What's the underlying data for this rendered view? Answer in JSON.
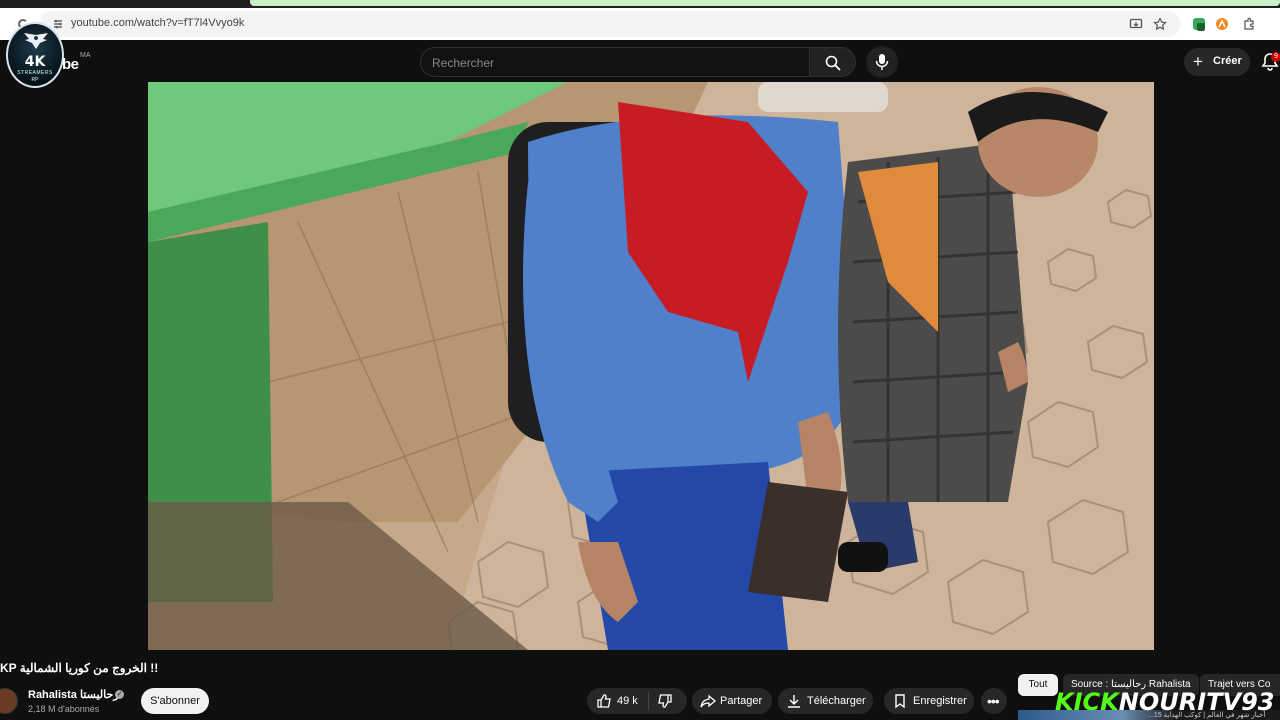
{
  "browser": {
    "url": "youtube.com/watch?v=fT7l4Vvyo9k"
  },
  "header": {
    "logo_text": "be",
    "country_code": "MA",
    "search_placeholder": "Rechercher",
    "create_label": "Créer",
    "notification_count": "9"
  },
  "channel_badge": {
    "main": "4K",
    "sub": "STREAMERS",
    "sub2": "RP"
  },
  "video": {
    "title": "KP الخروج من كوريا الشمالية !!",
    "channel_name": "Rahalista رحاليستا",
    "subscribers": "2,18 M d'abonnés",
    "subscribe_label": "S'abonner",
    "likes": "49 k",
    "share_label": "Partager",
    "download_label": "Télécharger",
    "save_label": "Enregistrer"
  },
  "chips": [
    {
      "label": "Tout",
      "active": true
    },
    {
      "label": "Source : رحاليستا Rahalista",
      "active": false
    },
    {
      "label": "Trajet vers Co",
      "active": false
    }
  ],
  "watermark": {
    "part1": "KICK",
    "part2": "NOURITV93"
  },
  "thumb_caption": "...أخبار شهر في العالم | كوكب الهداية 15",
  "colors": {
    "background": "#0f0f0f",
    "surface": "#272727",
    "subscribe_bg": "#f1f1f1",
    "kick_green": "#53fc18",
    "notification_red": "#cc0000"
  }
}
